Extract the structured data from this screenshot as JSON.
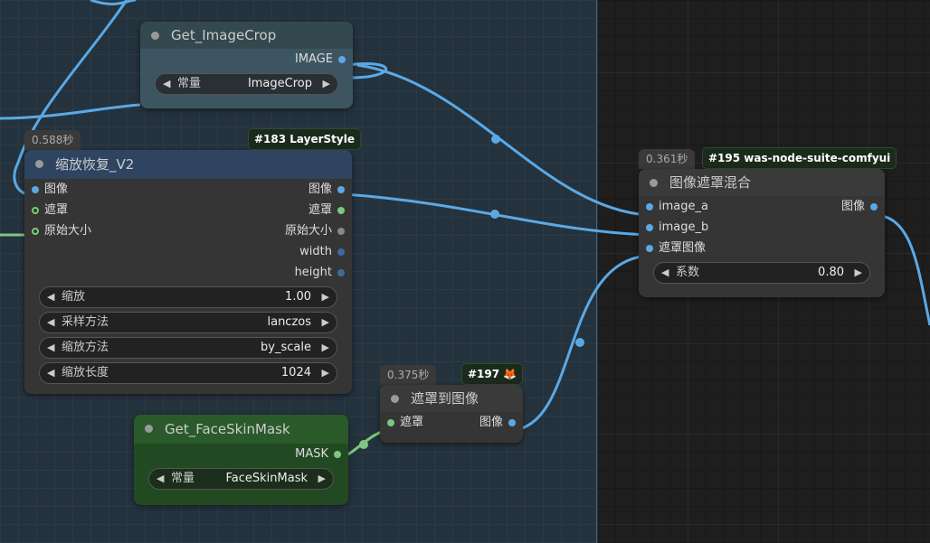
{
  "nodes": {
    "get_image_crop": {
      "title": "Get_ImageCrop",
      "output": "IMAGE",
      "widget_label": "常量",
      "widget_value": "ImageCrop"
    },
    "scale_restore": {
      "time": "0.588秒",
      "badge": "#183 LayerStyle",
      "title": "缩放恢复_V2",
      "inputs": [
        "图像",
        "遮罩",
        "原始大小"
      ],
      "outputs": [
        "图像",
        "遮罩",
        "原始大小",
        "width",
        "height"
      ],
      "widgets": [
        {
          "label": "缩放",
          "value": "1.00"
        },
        {
          "label": "采样方法",
          "value": "lanczos"
        },
        {
          "label": "缩放方法",
          "value": "by_scale"
        },
        {
          "label": "缩放长度",
          "value": "1024"
        }
      ]
    },
    "get_face_skin_mask": {
      "title": "Get_FaceSkinMask",
      "output": "MASK",
      "widget_label": "常量",
      "widget_value": "FaceSkinMask"
    },
    "mask_to_image": {
      "time": "0.375秒",
      "badge": "#197 🦊",
      "title": "遮罩到图像",
      "input": "遮罩",
      "output": "图像"
    },
    "image_mask_blend": {
      "time": "0.361秒",
      "badge": "#195 was-node-suite-comfyui",
      "title": "图像遮罩混合",
      "inputs": [
        "image_a",
        "image_b",
        "遮罩图像"
      ],
      "output": "图像",
      "widget_label": "系数",
      "widget_value": "0.80"
    }
  },
  "colors": {
    "image_wire": "#5aa9e6",
    "mask_wire": "#7fc57f",
    "group_bg": "#24323d",
    "canvas_bg": "#1e1e1e",
    "crop_node": "#3d5560",
    "skin_node": "#224a22",
    "scale_title": "#2e4460"
  }
}
